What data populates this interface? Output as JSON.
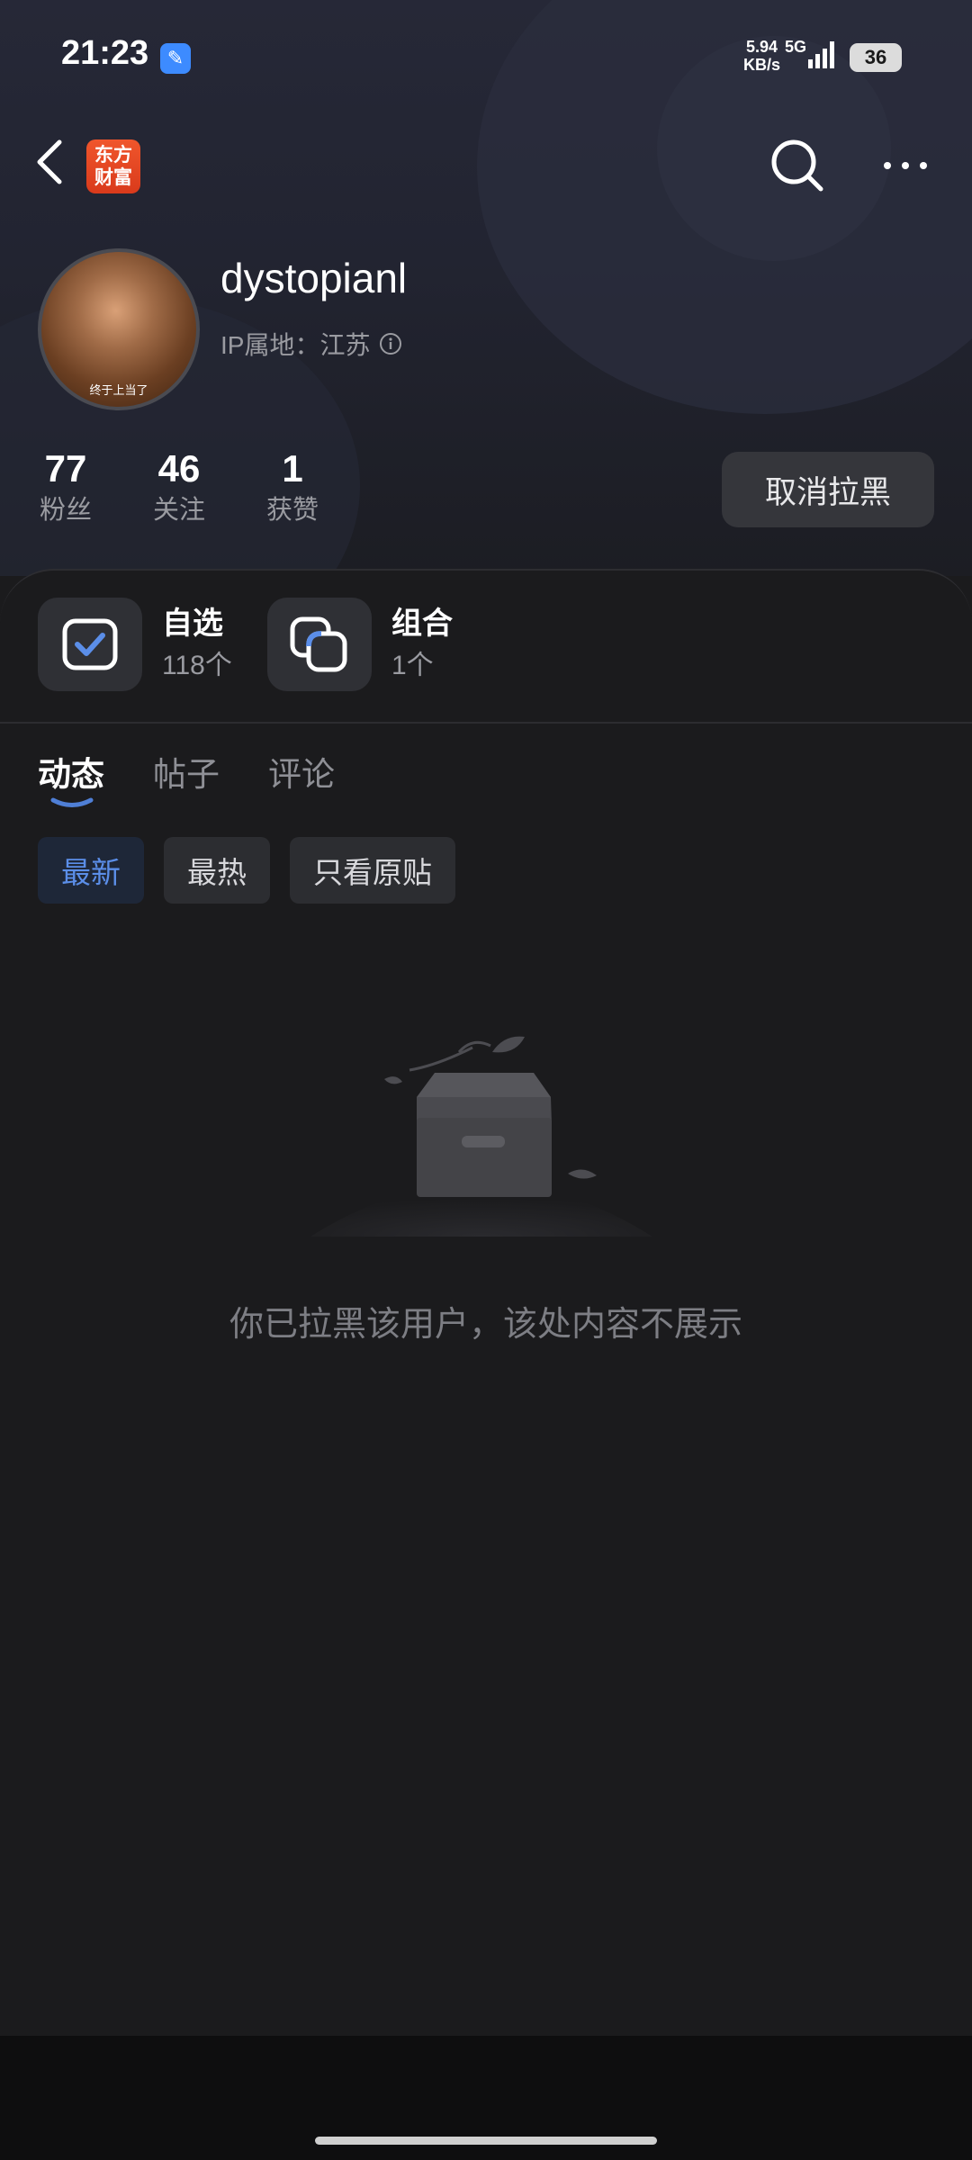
{
  "status_bar": {
    "time": "21:23",
    "speed_value": "5.94",
    "speed_unit": "KB/s",
    "network": "5G",
    "battery": "36",
    "icons": [
      "app-notification-icon",
      "signal-icon",
      "battery-icon"
    ]
  },
  "nav": {
    "logo_line1": "东方",
    "logo_line2": "财富",
    "icons": [
      "back-icon",
      "search-icon",
      "more-icon"
    ]
  },
  "profile": {
    "username": "dystopianl",
    "ip_label": "IP属地：江苏",
    "avatar_caption": "终于上当了",
    "stats": [
      {
        "value": "77",
        "label": "粉丝"
      },
      {
        "value": "46",
        "label": "关注"
      },
      {
        "value": "1",
        "label": "获赞"
      }
    ],
    "unblock_button": "取消拉黑"
  },
  "features": [
    {
      "title": "自选",
      "count": "118个",
      "icon": "watchlist-check-icon"
    },
    {
      "title": "组合",
      "count": "1个",
      "icon": "portfolio-icon"
    }
  ],
  "tabs": [
    {
      "label": "动态",
      "active": true
    },
    {
      "label": "帖子",
      "active": false
    },
    {
      "label": "评论",
      "active": false
    }
  ],
  "filters": [
    {
      "label": "最新",
      "active": true
    },
    {
      "label": "最热",
      "active": false
    },
    {
      "label": "只看原贴",
      "active": false
    }
  ],
  "empty_state": {
    "message": "你已拉黑该用户，该处内容不展示",
    "icon": "empty-box-icon"
  },
  "colors": {
    "accent": "#5b8ee8",
    "background": "#1b1b1d",
    "brand": "#e9482a"
  }
}
